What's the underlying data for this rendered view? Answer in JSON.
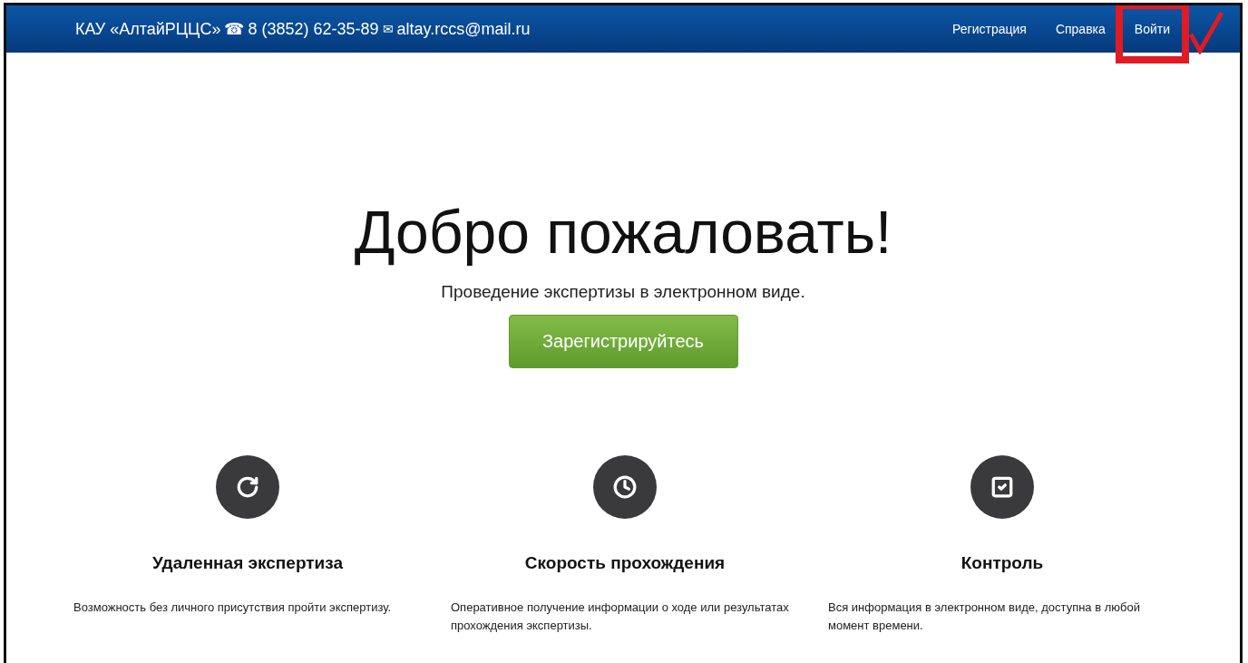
{
  "navbar": {
    "brand": "КАУ «АлтайРЦЦС»",
    "phone_icon": "☎",
    "phone": "8 (3852) 62-35-89",
    "mail_icon": "✉",
    "email": "altay.rccs@mail.ru",
    "links": [
      {
        "label": "Регистрация",
        "highlighted": false
      },
      {
        "label": "Справка",
        "highlighted": false
      },
      {
        "label": "Войти",
        "highlighted": true
      }
    ]
  },
  "hero": {
    "title": "Добро пожаловать!",
    "subtitle": "Проведение экспертизы в электронном виде.",
    "button": "Зарегистрируйтесь"
  },
  "features": [
    {
      "kind": "refresh",
      "title": "Удаленная экспертиза",
      "text": "Возможность без личного присутствия пройти экспертизу."
    },
    {
      "kind": "clock",
      "title": "Скорость прохождения",
      "text": "Оперативное получение информации о ходе или результатах прохождения экспертизы."
    },
    {
      "kind": "check",
      "title": "Контроль",
      "text": "Вся информация в электронном виде, доступна в любой момент времени."
    }
  ]
}
